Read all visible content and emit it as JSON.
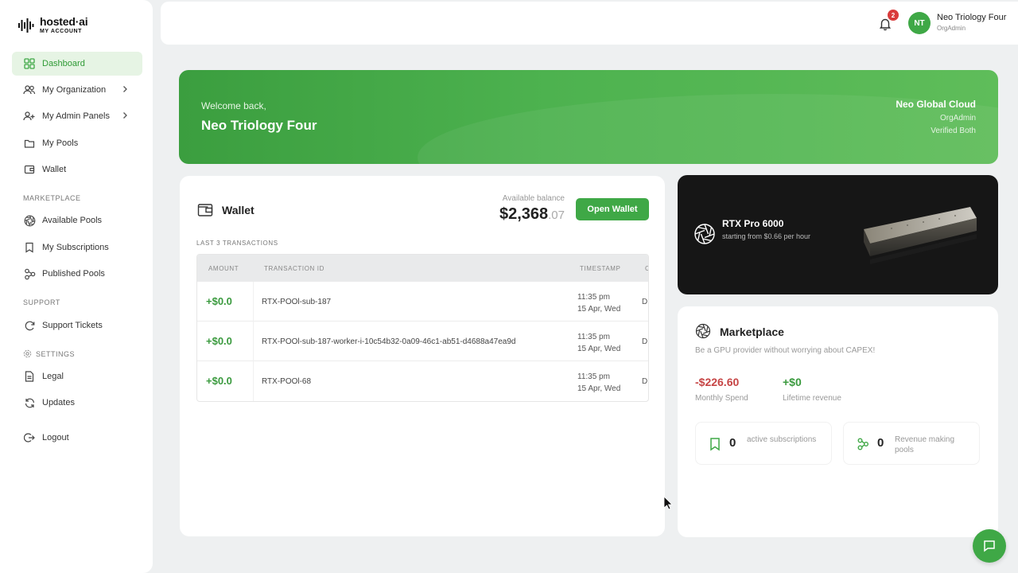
{
  "brand": {
    "name": "hosted·ai",
    "subtitle": "MY ACCOUNT"
  },
  "sidebar": {
    "items": [
      {
        "label": "Dashboard",
        "icon": "dashboard-icon",
        "active": true
      },
      {
        "label": "My Organization",
        "icon": "users-icon",
        "expandable": true
      },
      {
        "label": "My Admin Panels",
        "icon": "admin-icon",
        "expandable": true
      },
      {
        "label": "My Pools",
        "icon": "folder-icon"
      },
      {
        "label": "Wallet",
        "icon": "wallet-icon"
      }
    ],
    "marketplace_heading": "MARKETPLACE",
    "marketplace_items": [
      {
        "label": "Available Pools",
        "icon": "aperture-icon"
      },
      {
        "label": "My Subscriptions",
        "icon": "bookmark-icon"
      },
      {
        "label": "Published Pools",
        "icon": "nodes-icon"
      }
    ],
    "support_heading": "SUPPORT",
    "support_items": [
      {
        "label": "Support Tickets",
        "icon": "refresh-icon"
      }
    ],
    "settings_heading": "SETTINGS",
    "settings_items": [
      {
        "label": "Legal",
        "icon": "document-icon"
      },
      {
        "label": "Updates",
        "icon": "update-icon"
      }
    ],
    "logout_label": "Logout"
  },
  "topbar": {
    "notification_count": "2",
    "avatar_initials": "NT",
    "user_name": "Neo Triology Four",
    "user_role": "OrgAdmin"
  },
  "banner": {
    "greeting": "Welcome back,",
    "name": "Neo Triology Four",
    "org_name": "Neo Global Cloud",
    "org_role": "OrgAdmin",
    "verification": "Verified Both"
  },
  "wallet": {
    "title": "Wallet",
    "balance_label": "Available balance",
    "balance_main": "$2,368",
    "balance_cents": ".07",
    "open_button": "Open Wallet",
    "transactions_caption": "LAST 3 TRANSACTIONS",
    "columns": [
      "AMOUNT",
      "TRANSACTION ID",
      "TIMESTAMP",
      "C"
    ],
    "rows": [
      {
        "amount": "+$0.0",
        "id": "RTX-POOl-sub-187",
        "time": "11:35 pm",
        "date": "15 Apr, Wed",
        "extra": "D"
      },
      {
        "amount": "+$0.0",
        "id": "RTX-POOl-sub-187-worker-i-10c54b32-0a09-46c1-ab51-d4688a47ea9d",
        "time": "11:35 pm",
        "date": "15 Apr, Wed",
        "extra": "D"
      },
      {
        "amount": "+$0.0",
        "id": "RTX-POOl-68",
        "time": "11:35 pm",
        "date": "15 Apr, Wed",
        "extra": "D"
      }
    ]
  },
  "promo": {
    "title": "RTX Pro 6000",
    "subtitle": "starting from $0.66 per hour"
  },
  "marketplace": {
    "title": "Marketplace",
    "description": "Be a GPU provider without worrying about CAPEX!",
    "monthly_spend": "-$226.60",
    "monthly_spend_label": "Monthly Spend",
    "lifetime_revenue": "+$0",
    "lifetime_revenue_label": "Lifetime revenue",
    "active_subscriptions_count": "0",
    "active_subscriptions_label": "active subscriptions",
    "revenue_pools_count": "0",
    "revenue_pools_label": "Revenue making pools"
  },
  "colors": {
    "accent": "#3fa846",
    "negative": "#c64545",
    "positive": "#3a9a3e"
  }
}
